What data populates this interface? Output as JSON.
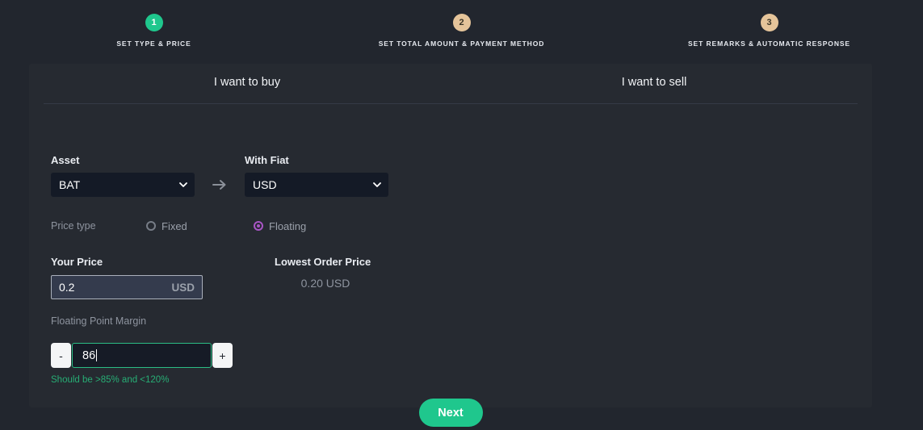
{
  "stepper": {
    "steps": [
      {
        "number": "1",
        "label": "SET TYPE & PRICE",
        "state": "active"
      },
      {
        "number": "2",
        "label": "SET TOTAL AMOUNT & PAYMENT METHOD",
        "state": "pending"
      },
      {
        "number": "3",
        "label": "SET REMARKS & AUTOMATIC RESPONSE",
        "state": "pending"
      }
    ]
  },
  "tabs": [
    {
      "label": "I want to buy",
      "selected": true
    },
    {
      "label": "I want to sell",
      "selected": false
    }
  ],
  "form": {
    "asset": {
      "label": "Asset",
      "value": "BAT"
    },
    "arrow_icon": "arrow-right-icon",
    "fiat": {
      "label": "With Fiat",
      "value": "USD"
    },
    "price_type": {
      "label": "Price type",
      "options": [
        {
          "label": "Fixed",
          "selected": false
        },
        {
          "label": "Floating",
          "selected": true
        }
      ]
    },
    "your_price": {
      "label": "Your Price",
      "value": "0.2",
      "unit": "USD"
    },
    "lowest_order_price": {
      "label": "Lowest Order Price",
      "value": "0.20 USD"
    },
    "floating_point_margin": {
      "label": "Floating Point Margin",
      "decrement_label": "-",
      "increment_label": "+",
      "value": "86",
      "helper_text": "Should be >85% and <120%"
    }
  },
  "actions": {
    "next_label": "Next"
  },
  "colors": {
    "page_bg": "#22262e",
    "card_bg": "#262a31",
    "accent_green": "#1fc78d",
    "helper_green": "#27ae75",
    "step_pending": "#e5c49a",
    "radio_purple": "#a855c5",
    "select_bg": "#141a26"
  }
}
